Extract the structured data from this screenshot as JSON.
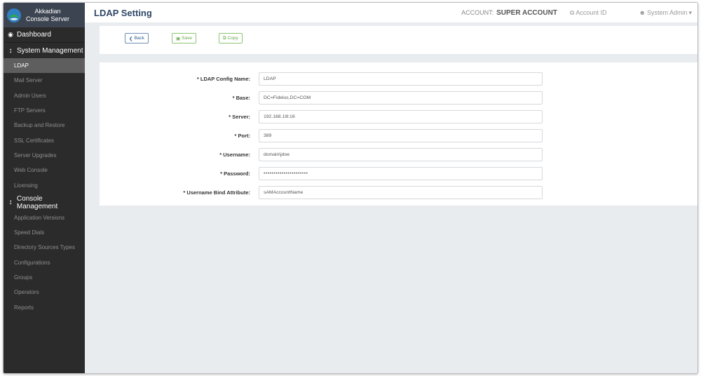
{
  "brand": {
    "line1": "Akkadian",
    "line2": "Console Server"
  },
  "header": {
    "title": "LDAP Setting",
    "account_label": "ACCOUNT:",
    "account_value": "SUPER ACCOUNT",
    "account_id_label": "Account ID",
    "user_label": "System Admin",
    "user_caret": "▾"
  },
  "sidebar": {
    "dashboard": "Dashboard",
    "system_management": {
      "label": "System Management",
      "items": [
        "LDAP",
        "Mail Server",
        "Admin Users",
        "FTP Servers",
        "Backup and Restore",
        "SSL Certificates",
        "Server Upgrades",
        "Web Console",
        "Licensing"
      ],
      "active": "LDAP"
    },
    "console_management": {
      "label": "Console Management",
      "items": [
        "Application Versions",
        "Speed Dials",
        "Directory Sources Types",
        "Configurations",
        "Groups",
        "Operators",
        "Reports"
      ]
    }
  },
  "toolbar": {
    "back_label": "Back",
    "save_label": "Save",
    "copy_label": "Copy"
  },
  "form": {
    "fields": [
      {
        "label": "* LDAP Config Name:",
        "value": "LDAP"
      },
      {
        "label": "* Base:",
        "value": "DC=Fidelus,DC=COM"
      },
      {
        "label": "* Server:",
        "value": "192.168.1Ill:16"
      },
      {
        "label": "* Port:",
        "value": "389"
      },
      {
        "label": "* Username:",
        "value": "domain\\jdoe"
      },
      {
        "label": "* Password:",
        "value": "••••••••••••••••••••••"
      },
      {
        "label": "* Username Bind Attribute:",
        "value": "sAMAccountName"
      }
    ]
  },
  "colors": {
    "sidebar": "#2b2b2b",
    "brand_bg": "#3c4451",
    "title": "#2f4766",
    "success": "#6aa84f",
    "primary": "#2f5e8e"
  }
}
